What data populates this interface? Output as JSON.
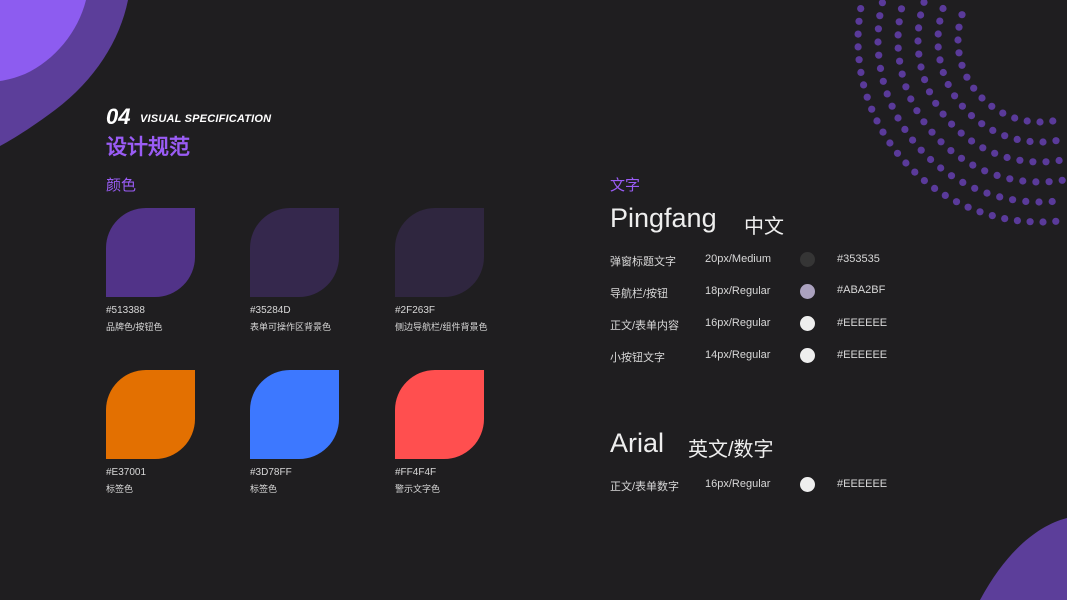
{
  "header": {
    "number": "04",
    "subtitle_en": "VISUAL SPECIFICATION",
    "title_cn": "设计规范"
  },
  "colors": {
    "section_title": "颜色",
    "swatches": [
      {
        "hex": "#513388",
        "desc": "品牌色/按钮色",
        "color": "#513388"
      },
      {
        "hex": "#35284D",
        "desc": "表单可操作区背景色",
        "color": "#35284D"
      },
      {
        "hex": "#2F263F",
        "desc": "侧边导航栏/组件背景色",
        "color": "#2F263F"
      },
      {
        "hex": "#E37001",
        "desc": "标签色",
        "color": "#E37001"
      },
      {
        "hex": "#3D78FF",
        "desc": "标签色",
        "color": "#3D78FF"
      },
      {
        "hex": "#FF4F4F",
        "desc": "警示文字色",
        "color": "#FF4F4F"
      }
    ]
  },
  "typography": {
    "section_title": "文字",
    "fonts": [
      {
        "name": "Pingfang",
        "sub": "中文",
        "rows": [
          {
            "label": "弹窗标题文字",
            "spec": "20px/Medium",
            "hex": "#353535",
            "color": "#353535"
          },
          {
            "label": "导航栏/按钮",
            "spec": "18px/Regular",
            "hex": "#ABA2BF",
            "color": "#ABA2BF"
          },
          {
            "label": "正文/表单内容",
            "spec": "16px/Regular",
            "hex": "#EEEEEE",
            "color": "#EEEEEE"
          },
          {
            "label": "小按钮文字",
            "spec": "14px/Regular",
            "hex": "#EEEEEE",
            "color": "#EEEEEE"
          }
        ]
      },
      {
        "name": "Arial",
        "sub": "英文/数字",
        "rows": [
          {
            "label": "正文/表单数字",
            "spec": "16px/Regular",
            "hex": "#EEEEEE",
            "color": "#EEEEEE"
          }
        ]
      }
    ]
  },
  "decor_colors": {
    "blob_light": "#8d5cf0",
    "blob_dark": "#5c3e9a",
    "dots": "#5a3a9a"
  }
}
